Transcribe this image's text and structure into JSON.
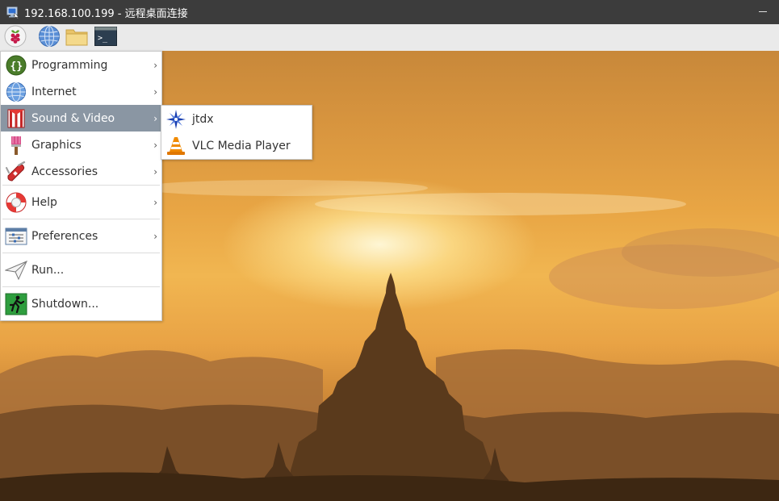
{
  "window": {
    "title": "192.168.100.199 - 远程桌面连接"
  },
  "panel": {
    "buttons": [
      {
        "name": "raspberry-menu",
        "icon": "raspberry-icon"
      },
      {
        "name": "web-browser",
        "icon": "globe-icon"
      },
      {
        "name": "file-manager",
        "icon": "folder-icon"
      },
      {
        "name": "terminal",
        "icon": "terminal-icon"
      }
    ]
  },
  "menu": {
    "items": [
      {
        "label": "Programming",
        "icon": "programming-icon",
        "has_submenu": true
      },
      {
        "label": "Internet",
        "icon": "globe-icon",
        "has_submenu": true
      },
      {
        "label": "Sound & Video",
        "icon": "sound-video-icon",
        "has_submenu": true,
        "active": true
      },
      {
        "label": "Graphics",
        "icon": "paintbrush-icon",
        "has_submenu": true
      },
      {
        "label": "Accessories",
        "icon": "swiss-knife-icon",
        "has_submenu": true
      },
      {
        "label": "Help",
        "icon": "lifebuoy-icon",
        "has_submenu": true
      },
      {
        "label": "Preferences",
        "icon": "preferences-icon",
        "has_submenu": true
      },
      {
        "label": "Run...",
        "icon": "paper-plane-icon",
        "has_submenu": false
      },
      {
        "label": "Shutdown...",
        "icon": "exit-icon",
        "has_submenu": false
      }
    ]
  },
  "submenu": {
    "items": [
      {
        "label": "jtdx",
        "icon": "compass-star-icon"
      },
      {
        "label": "VLC Media Player",
        "icon": "vlc-cone-icon"
      }
    ]
  },
  "colors": {
    "titlebar": "#3c3c3c",
    "panel": "#eaeaea",
    "menu_highlight": "#8a96a3",
    "vlc_orange": "#f08a00"
  }
}
